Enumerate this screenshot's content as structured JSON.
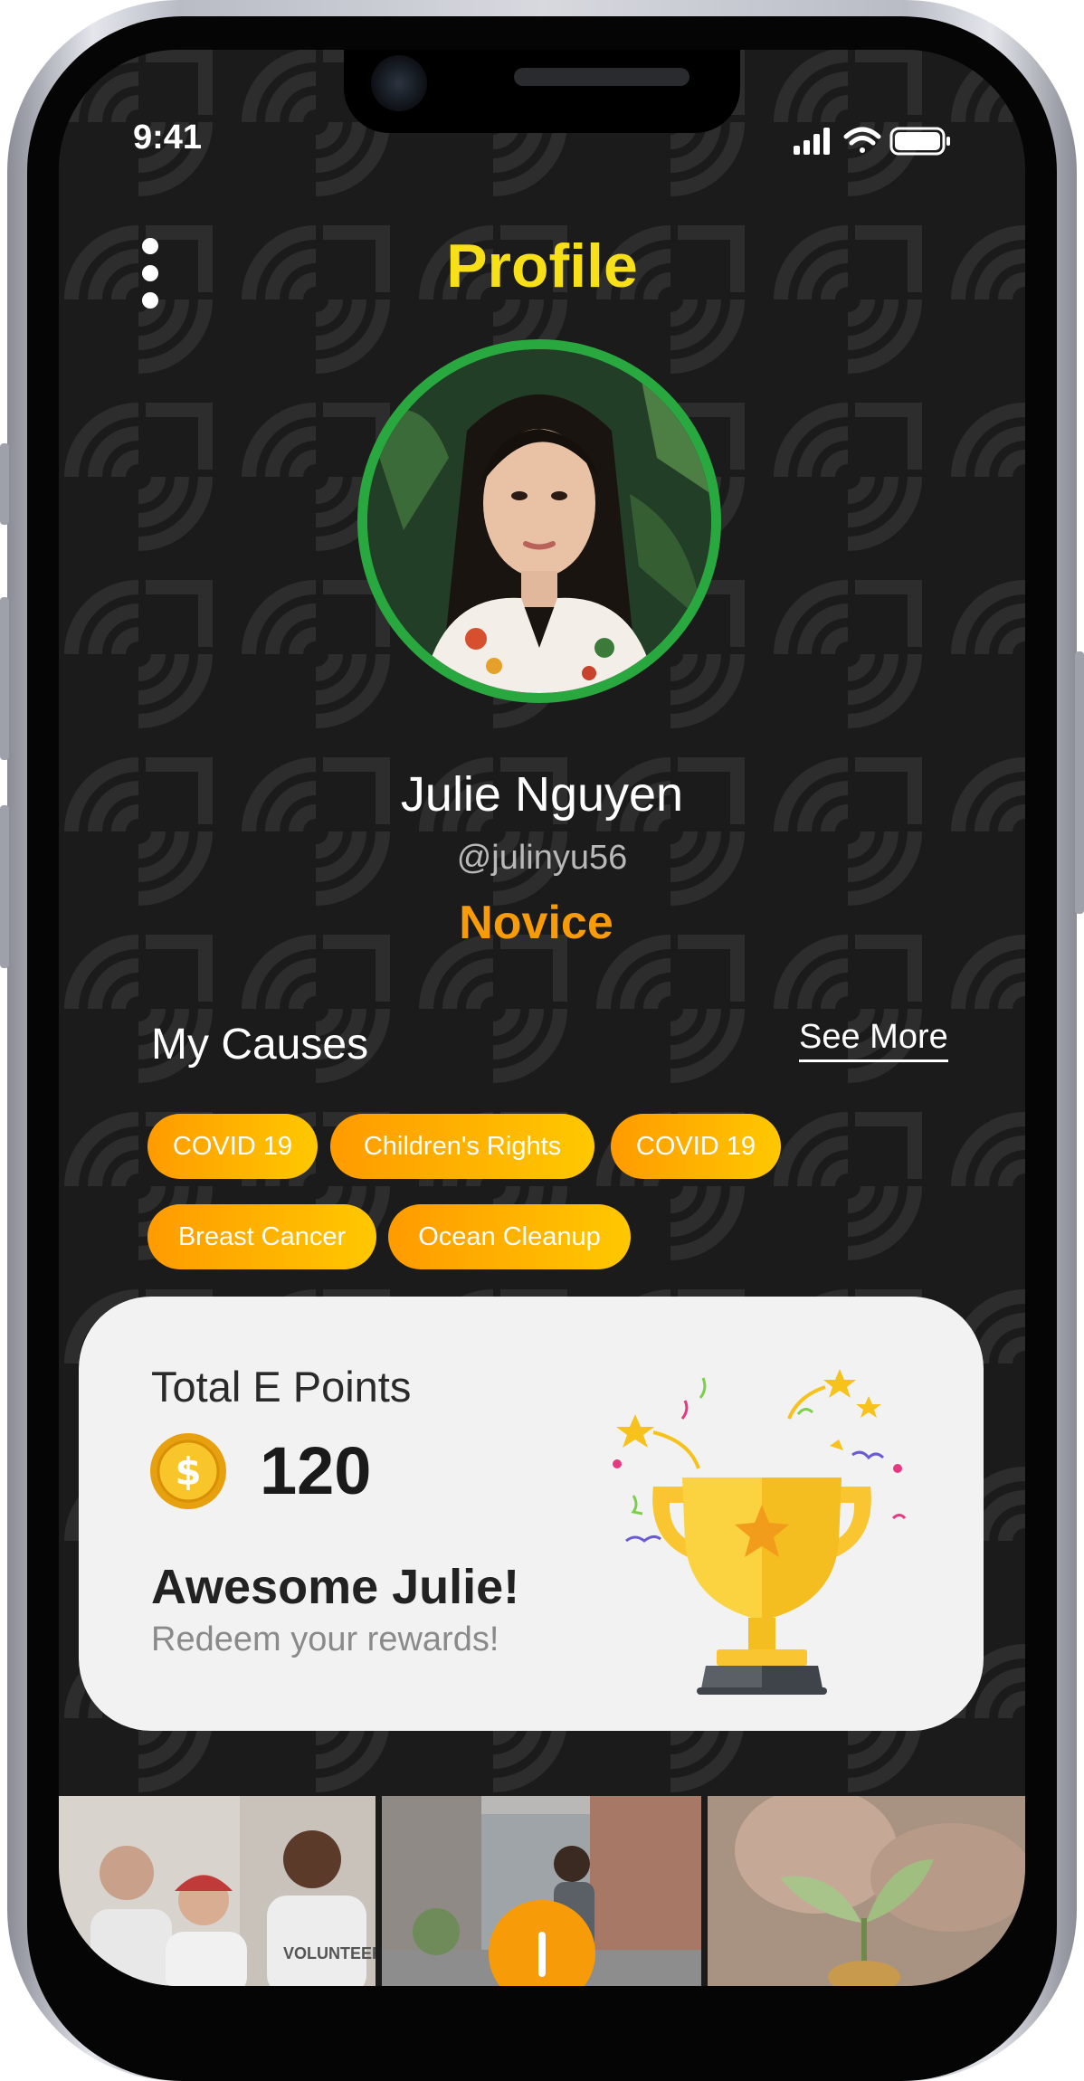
{
  "status_bar": {
    "time": "9:41"
  },
  "header": {
    "title": "Profile"
  },
  "profile": {
    "name": "Julie Nguyen",
    "handle": "@julinyu56",
    "level": "Novice"
  },
  "causes": {
    "title": "My Causes",
    "see_more": "See More",
    "chips": [
      "COVID 19",
      "Children's Rights",
      "COVID 19",
      "Breast Cancer",
      "Ocean Cleanup"
    ]
  },
  "points_card": {
    "label": "Total E Points",
    "value": "120",
    "headline": "Awesome Julie!",
    "subtext": "Redeem your rewards!"
  },
  "icons": {
    "menu": "more-vertical-icon",
    "coin": "dollar-coin-icon",
    "trophy": "trophy-icon",
    "fab": "plus-icon",
    "signal": "signal-icon",
    "wifi": "wifi-icon",
    "battery": "battery-icon"
  },
  "colors": {
    "title": "#f7e018",
    "level": "#f79b09",
    "avatar_ring": "#2aa840",
    "chip_start": "#ff9b00",
    "chip_end": "#ffc800",
    "background": "#1b1b1b",
    "card": "#f2f2f2"
  }
}
